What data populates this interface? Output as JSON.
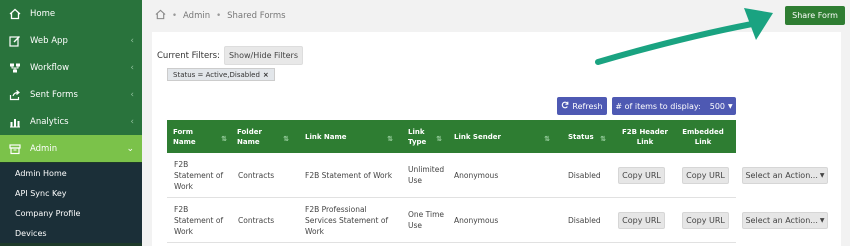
{
  "sidebar": {
    "items": [
      {
        "label": "Home",
        "icon": "home-icon",
        "chevron": ""
      },
      {
        "label": "Web App",
        "icon": "edit-icon",
        "chevron": "‹"
      },
      {
        "label": "Workflow",
        "icon": "workflow-icon",
        "chevron": "‹"
      },
      {
        "label": "Sent Forms",
        "icon": "share-icon",
        "chevron": "‹"
      },
      {
        "label": "Analytics",
        "icon": "analytics-icon",
        "chevron": "‹"
      },
      {
        "label": "Admin",
        "icon": "admin-icon",
        "chevron": "⌄"
      }
    ],
    "subitems": [
      "Admin Home",
      "API Sync Key",
      "Company Profile",
      "Devices"
    ]
  },
  "breadcrumb": {
    "sep": "•",
    "items": [
      "Admin",
      "Shared Forms"
    ]
  },
  "toolbar": {
    "share_label": "Share Form"
  },
  "filters": {
    "label": "Current Filters:",
    "toggle_label": "Show/Hide Filters",
    "badge": "Status = Active,Disabled",
    "badge_close": "×"
  },
  "table_controls": {
    "refresh_label": "Refresh",
    "items_label": "# of items to display:",
    "items_value": "500"
  },
  "table": {
    "headers": [
      "Form Name",
      "Folder Name",
      "Link Name",
      "Link Type",
      "Link Sender",
      "Status",
      "F2B Header Link",
      "Embedded Link"
    ],
    "rows": [
      {
        "form_name": "F2B Statement of Work",
        "folder_name": "Contracts",
        "link_name": "F2B Statement of Work",
        "link_type": "Unlimited Use",
        "link_sender": "Anonymous",
        "status": "Disabled",
        "header_link": "Copy URL",
        "embedded_link": "Copy URL",
        "action": "Select an Action..."
      },
      {
        "form_name": "F2B Statement of Work",
        "folder_name": "Contracts",
        "link_name": "F2B Professional Services Statement of Work",
        "link_type": "One Time Use",
        "link_sender": "Anonymous",
        "status": "Disabled",
        "header_link": "Copy URL",
        "embedded_link": "Copy URL",
        "action": "Select an Action..."
      }
    ]
  },
  "colors": {
    "sidebar_green": "#29733c",
    "active_green": "#7bc24a",
    "header_green": "#2e7d32",
    "blue_button": "#4e59b3",
    "annotation_arrow": "#1aa381"
  }
}
